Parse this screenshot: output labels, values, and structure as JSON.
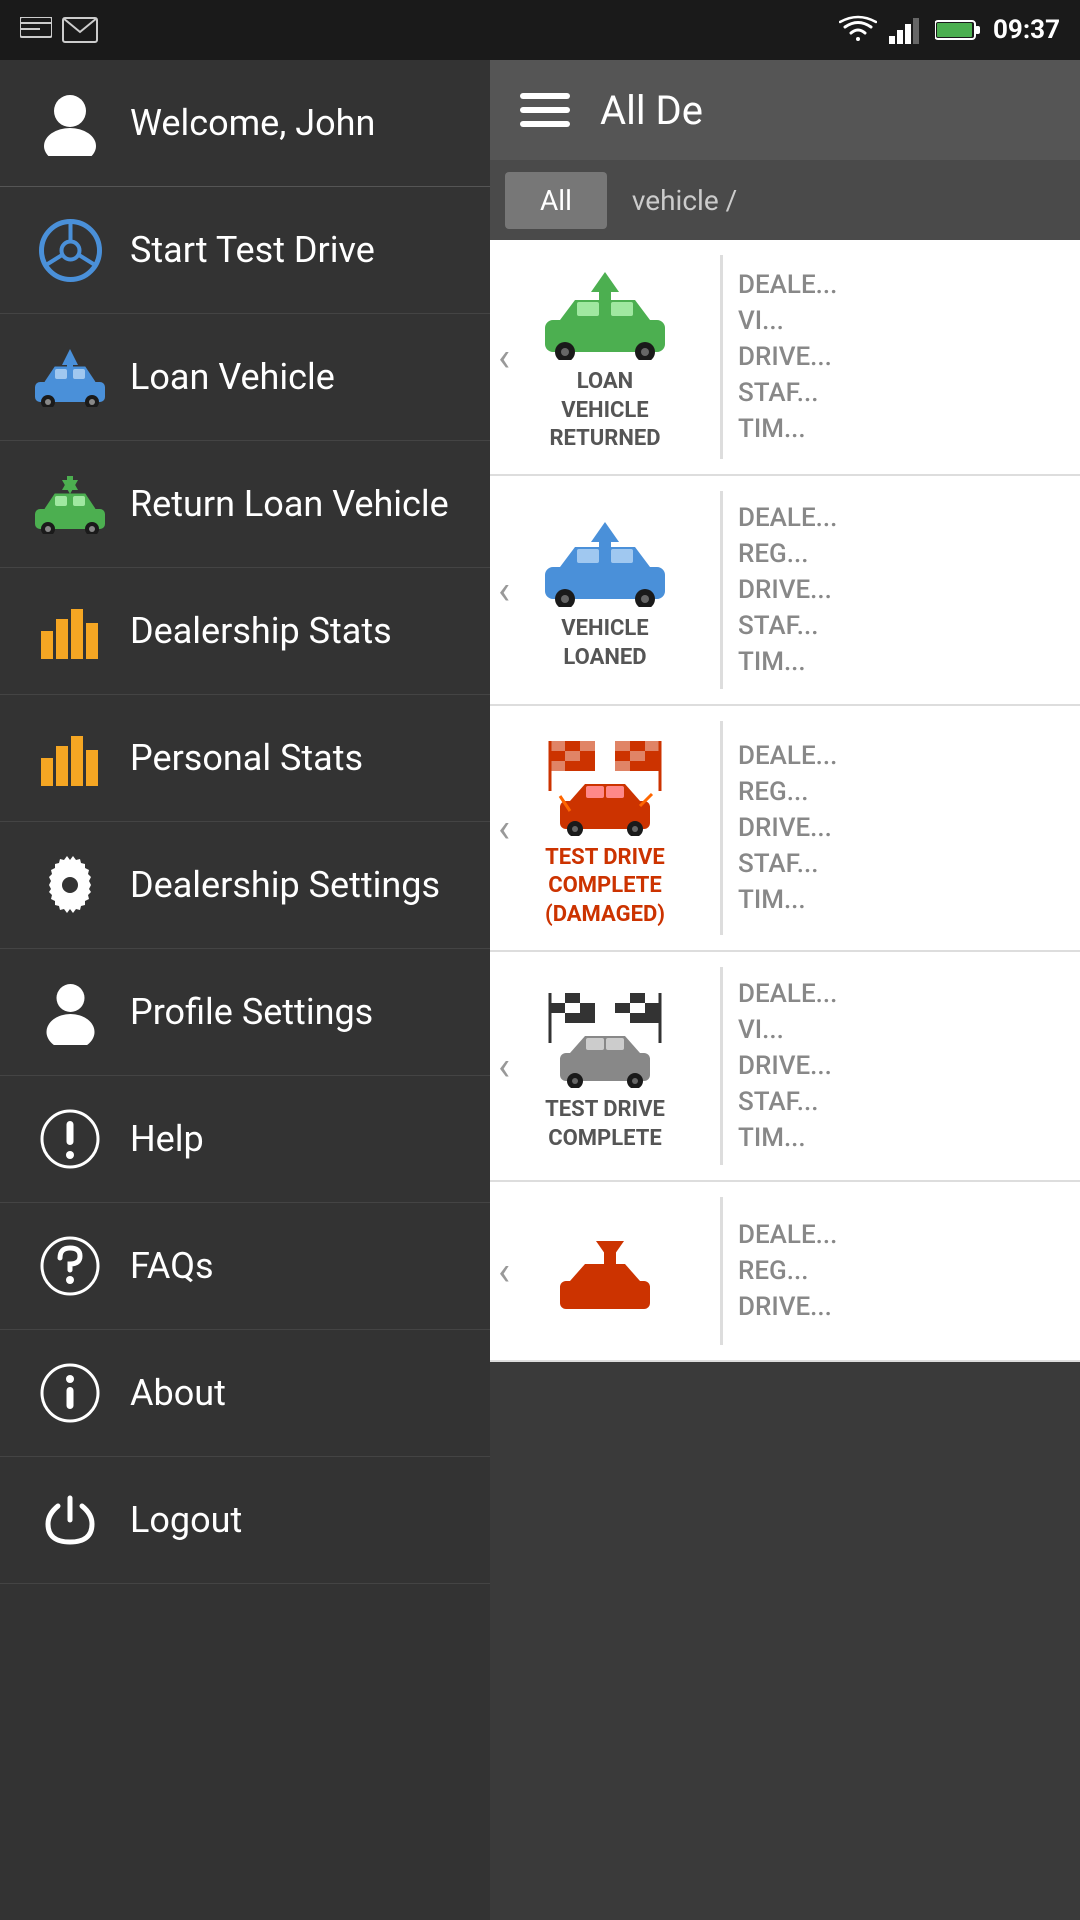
{
  "statusBar": {
    "time": "09:37",
    "icons": [
      "notification",
      "email",
      "wifi",
      "signal",
      "battery"
    ]
  },
  "sidebar": {
    "items": [
      {
        "id": "welcome",
        "label": "Welcome, John",
        "icon": "user"
      },
      {
        "id": "start-test-drive",
        "label": "Start Test Drive",
        "icon": "steering-wheel"
      },
      {
        "id": "loan-vehicle",
        "label": "Loan Vehicle",
        "icon": "car-up"
      },
      {
        "id": "return-loan-vehicle",
        "label": "Return Loan Vehicle",
        "icon": "car-down"
      },
      {
        "id": "dealership-stats",
        "label": "Dealership Stats",
        "icon": "bar-chart"
      },
      {
        "id": "personal-stats",
        "label": "Personal Stats",
        "icon": "bar-chart"
      },
      {
        "id": "dealership-settings",
        "label": "Dealership Settings",
        "icon": "gear"
      },
      {
        "id": "profile-settings",
        "label": "Profile Settings",
        "icon": "user"
      },
      {
        "id": "help",
        "label": "Help",
        "icon": "exclamation"
      },
      {
        "id": "faqs",
        "label": "FAQs",
        "icon": "question"
      },
      {
        "id": "about",
        "label": "About",
        "icon": "info"
      },
      {
        "id": "logout",
        "label": "Logout",
        "icon": "power"
      }
    ]
  },
  "rightPanel": {
    "headerTitle": "All De",
    "hamburgerLabel": "Menu",
    "filterTabs": [
      {
        "id": "all",
        "label": "All",
        "active": true
      },
      {
        "id": "vehicle",
        "label": "vehicle /",
        "active": false
      }
    ],
    "cards": [
      {
        "id": "loan-vehicle-returned",
        "type": "loan-returned",
        "label": "LOAN\nVEHICLE\nRETURNED",
        "rows": [
          "DEALE",
          "VI",
          "DRIVE",
          "STAF",
          "TIM"
        ]
      },
      {
        "id": "vehicle-loaned",
        "type": "loaned",
        "label": "VEHICLE\nLOANED",
        "rows": [
          "DEALE",
          "REG",
          "DRIVE",
          "STAF",
          "TIM"
        ]
      },
      {
        "id": "test-drive-complete-damaged",
        "type": "test-drive-damaged",
        "label": "TEST DRIVE\nCOMPLETE\n(DAMAGED)",
        "rows": [
          "DEALE",
          "REG",
          "DRIVE",
          "STAF",
          "TIM"
        ]
      },
      {
        "id": "test-drive-complete",
        "type": "test-drive",
        "label": "TEST DRIVE\nCOMPLETE",
        "rows": [
          "DEALE",
          "VI",
          "DRIVE",
          "STAF",
          "TIM"
        ]
      },
      {
        "id": "partial-card",
        "type": "partial",
        "label": "",
        "rows": [
          "DEALE",
          "REG",
          "DRIVE"
        ]
      }
    ]
  }
}
